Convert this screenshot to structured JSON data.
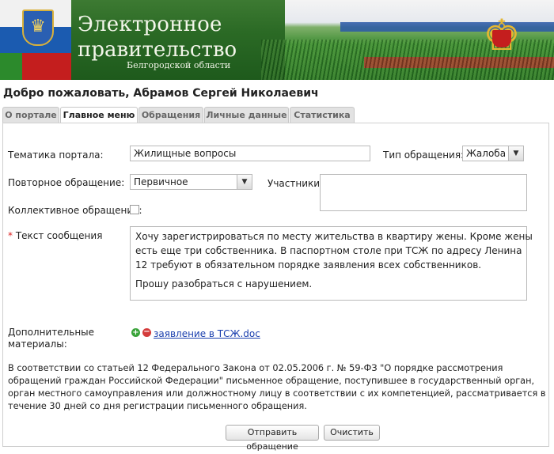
{
  "header": {
    "title_line1": "Электронное",
    "title_line2": "правительство",
    "subtitle": "Белгородской области",
    "coat_of_arms_icon": "belgorod-coat-of-arms-icon",
    "eagle_icon": "russian-eagle-emblem-icon",
    "colors": {
      "green": "#2b6a25",
      "blue": "#1b5bb0",
      "red": "#c41e1e"
    }
  },
  "welcome": "Добро пожаловать, Абрамов Сергей Николаевич",
  "tabs": [
    {
      "label": "О портале",
      "active": false
    },
    {
      "label": "Главное меню",
      "active": true
    },
    {
      "label": "Обращения",
      "active": false
    },
    {
      "label": "Личные данные",
      "active": false
    },
    {
      "label": "Статистика",
      "active": false
    }
  ],
  "form": {
    "topic_label": "Тематика портала:",
    "topic_value": "Жилищные вопросы",
    "type_label": "Тип обращения:",
    "type_value": "Жалоба",
    "repeat_label": "Повторное обращение:",
    "repeat_value": "Первичное",
    "participants_label": "Участники:",
    "collective_label": "Коллективное обращение:",
    "collective_checked": false,
    "required_mark": "*",
    "text_label": "Текст сообщения",
    "text_paragraph1": "Хочу зарегистрироваться по месту жительства в квартиру жены. Кроме жены есть еще три собственника. В паспортном столе при ТСЖ по адресу Ленина 12 требуют в обязательном порядке заявления всех  собственников.",
    "text_paragraph2": "Прошу разобраться с нарушением.",
    "attachments_label_line1": "Дополнительные",
    "attachments_label_line2": "материалы:",
    "add_icon_glyph": "+",
    "remove_icon_glyph": "−",
    "attachment_file": "заявление в ТСЖ.doc"
  },
  "notice": "В соответствии со статьей 12 Федерального Закона от 02.05.2006 г. № 59-ФЗ \"О порядке рассмотрения обращений граждан Российской Федерации\" письменное обращение, поступившее в государственный орган, орган местного самоуправления или должностному лицу в соответствии с их компетенцией, рассматривается в течение 30 дней со дня регистрации письменного обращения.",
  "buttons": {
    "submit": "Отправить обращение",
    "clear": "Очистить"
  }
}
